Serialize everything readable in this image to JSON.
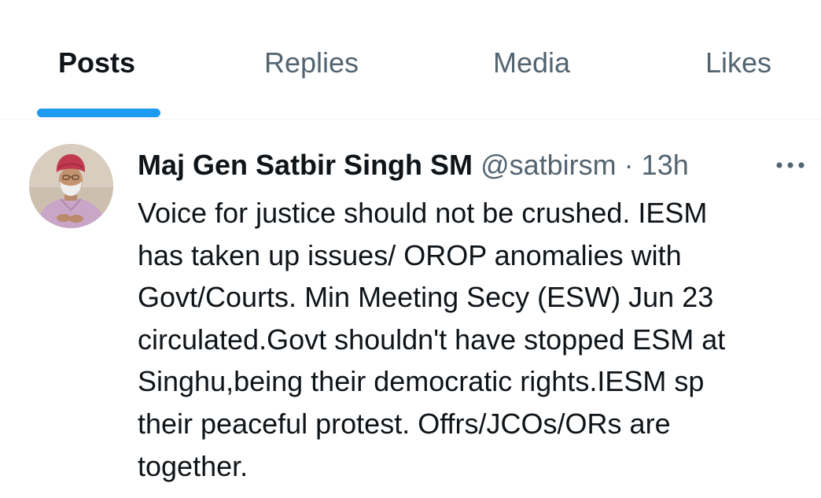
{
  "tabs": [
    {
      "label": "Posts",
      "active": true
    },
    {
      "label": "Replies",
      "active": false
    },
    {
      "label": "Media",
      "active": false
    },
    {
      "label": "Likes",
      "active": false
    }
  ],
  "accent_color": "#1d9bf0",
  "post": {
    "author_name": "Maj Gen Satbir Singh SM",
    "handle": "@satbirsm",
    "separator": "·",
    "time": "13h",
    "more_icon": "more-horizontal-icon",
    "text": "Voice for justice  should not  be crushed. IESM\nhas taken up  issues/ OROP anomalies  with\nGovt/Courts. Min Meeting Secy (ESW) Jun 23\ncirculated.Govt shouldn't have  stopped ESM at\nSinghu,being their democratic  rights.IESM sp\ntheir peaceful protest. Offrs/JCOs/ORs are\ntogether."
  }
}
